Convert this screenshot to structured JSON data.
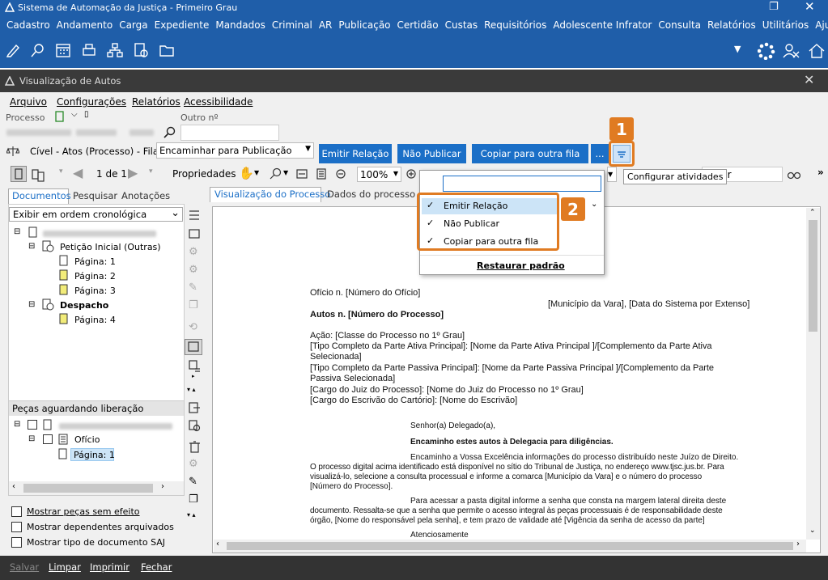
{
  "window": {
    "title": "Sistema de Automação da Justiça - Primeiro Grau"
  },
  "menu": [
    "Cadastro",
    "Andamento",
    "Carga",
    "Expediente",
    "Mandados",
    "Criminal",
    "AR",
    "Publicação",
    "Certidão",
    "Custas",
    "Requisitórios",
    "Adolescente Infrator",
    "Consulta",
    "Relatórios",
    "Utilitários",
    "Ajuda"
  ],
  "inner": {
    "title": "Visualização de Autos"
  },
  "inner_menu": [
    "Arquivo",
    "Configurações",
    "Relatórios",
    "Acessibilidade"
  ],
  "fields": {
    "processo_label": "Processo",
    "outro_label": "Outro nº"
  },
  "queue": {
    "label": "Cível - Atos (Processo) - Fila:",
    "value": "Encaminhar para Publicação"
  },
  "actions": {
    "emitir": "Emitir Relação",
    "nao_publicar": "Não Publicar",
    "copiar": "Copiar para outra fila",
    "more": "..."
  },
  "viewer": {
    "page": "1 de 1",
    "propriedades": "Propriedades",
    "zoom": "100%",
    "search_partial": "alizar"
  },
  "tooltip": "Configurar atividades",
  "dropdown": {
    "items": [
      "Emitir Relação",
      "Não Publicar",
      "Copiar para outra fila"
    ],
    "restore": "Restaurar padrão"
  },
  "left_tabs": [
    "Documentos",
    "Pesquisar",
    "Anotações"
  ],
  "order": "Exibir em ordem cronológica",
  "tree": {
    "peticao": "Petição Inicial (Outras)",
    "pag1": "Página: 1",
    "pag2": "Página: 2",
    "pag3": "Página: 3",
    "despacho": "Despacho",
    "pag4": "Página: 4"
  },
  "pecas": {
    "title": "Peças aguardando liberação",
    "oficio": "Ofício",
    "pag1": "Página: 1"
  },
  "checks": [
    "Mostrar peças sem efeito",
    "Mostrar dependentes arquivados",
    "Mostrar tipo de documento SAJ"
  ],
  "doc_tabs": [
    "Visualização do Processo",
    "Dados do processo"
  ],
  "doc": {
    "l1": "Ofício n. [Número do Ofício]",
    "l2": "[Município da Vara], [Data do Sistema por Extenso]",
    "l3": "Autos n. [Número do Processo]",
    "l4": "Ação: [Classe do Processo no 1º Grau]",
    "l5": "[Tipo Completo da Parte Ativa Principal]: [Nome da Parte Ativa Principal ]/[Complemento da Parte Ativa",
    "l6": "Selecionada]",
    "l7": "[Tipo Completo da Parte Passiva Principal]: [Nome da Parte Passiva Principal ]/[Complemento da Parte",
    "l8": "Passiva Selecionada]",
    "l9": "[Cargo do Juiz do Processo]: [Nome do Juiz do Processo no 1º Grau]",
    "l10": "[Cargo do Escrivão do Cartório]: [Nome do Escrivão]",
    "l11": "Senhor(a) Delegado(a),",
    "l12": "Encaminho estes autos à Delegacia para diligências.",
    "l13": "Encaminho a Vossa Excelência informações do processo distribuído neste Juízo de Direito.",
    "l14": "O processo digital acima identificado está disponível no sítio do Tribunal de Justiça, no endereço www.tjsc.jus.br. Para",
    "l15": "visualizá-lo, selecione a consulta processual e informe a comarca [Município da Vara] e o número do processo",
    "l16": "[Número do Processo].",
    "l17": "Para acessar a pasta digital informe a senha que consta na margem lateral direita deste",
    "l18": "documento. Ressalta-se que a senha que permite o acesso integral às peças processuais é de responsabilidade deste",
    "l19": "órgão, [Nome do responsável pela senha], e tem prazo de validade até [Vigência da senha de acesso da parte]",
    "l20": "Atenciosamente"
  },
  "bottom": [
    "Salvar",
    "Limpar",
    "Imprimir",
    "Fechar"
  ],
  "badges": [
    "1",
    "2"
  ]
}
